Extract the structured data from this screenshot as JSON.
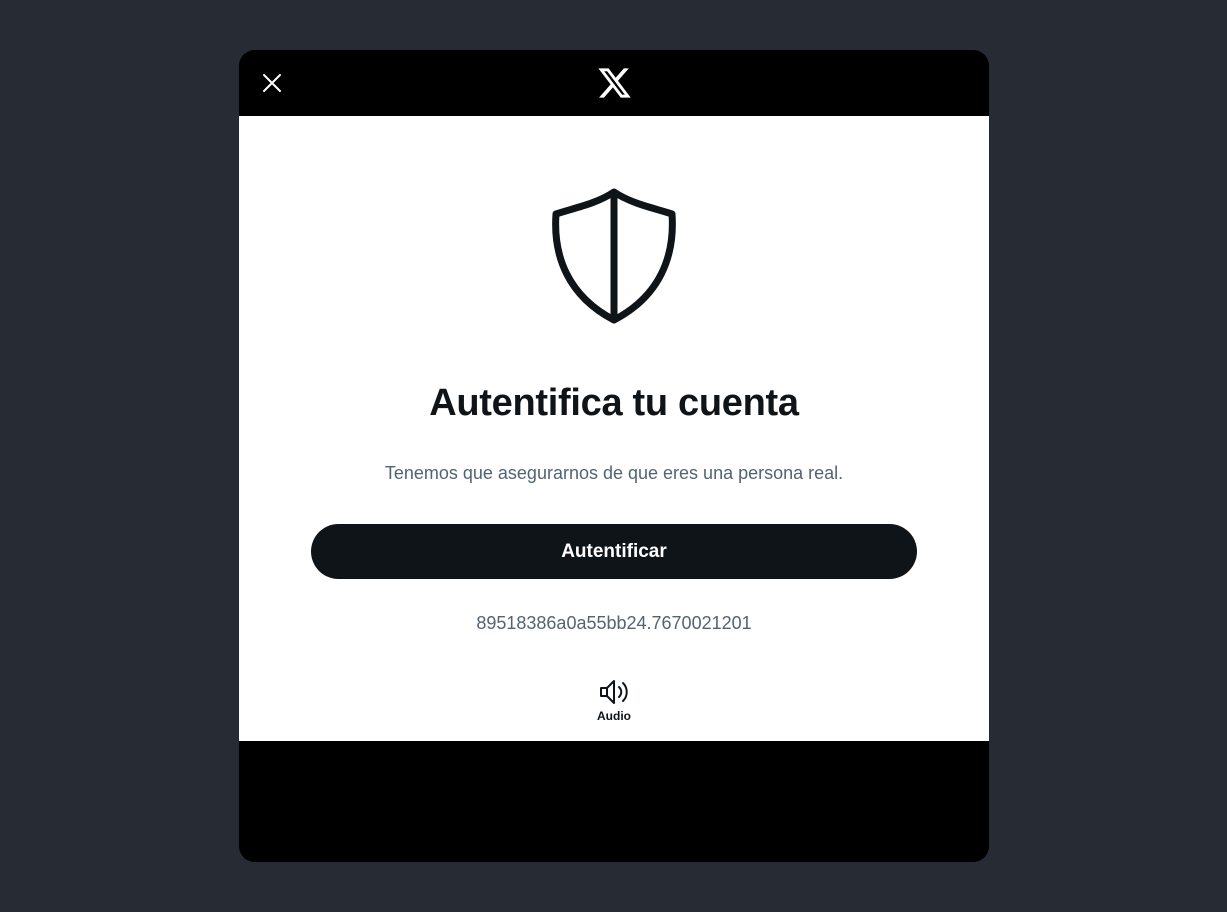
{
  "header": {
    "close_icon": "close-icon",
    "logo_icon": "x-logo-icon"
  },
  "main": {
    "shield_icon": "shield-icon",
    "title": "Autentifica tu cuenta",
    "subtitle": "Tenemos que asegurarnos de que eres una persona real.",
    "authenticate_label": "Autentificar",
    "session_id": "89518386a0a55bb24.7670021201",
    "audio": {
      "icon": "speaker-icon",
      "label": "Audio"
    }
  },
  "colors": {
    "page_background": "#272c34",
    "modal_chrome": "#000000",
    "content_background": "#ffffff",
    "primary_text": "#0f1419",
    "secondary_text": "#536471",
    "button_background": "#0f1419",
    "button_text": "#ffffff"
  }
}
